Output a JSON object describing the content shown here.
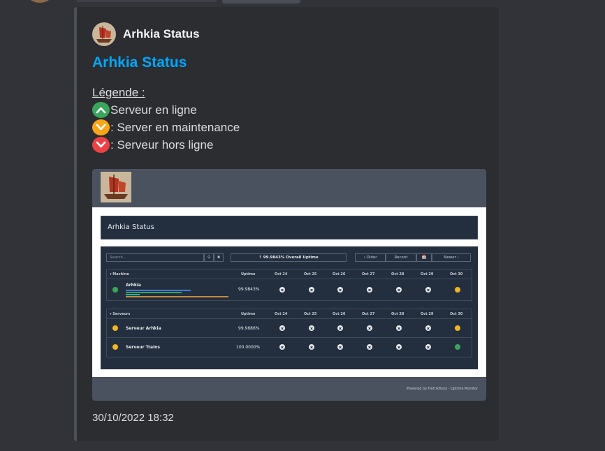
{
  "embed": {
    "author_name": "Arhkia Status",
    "title": "Arhkia Status",
    "legend_title": "Légende :",
    "legend": [
      {
        "color": "green",
        "icon": "chevron-up-icon",
        "text": "Serveur en ligne"
      },
      {
        "color": "yellow",
        "icon": "chevron-down-icon",
        "text": ": Server en maintenance"
      },
      {
        "color": "red",
        "icon": "chevron-down-icon",
        "text": ": Serveur hors ligne"
      }
    ],
    "timestamp": "30/10/2022 18:32",
    "colors": {
      "link": "#00a8fc",
      "green": "#3ba55d",
      "yellow": "#faa61a",
      "red": "#ed4245"
    }
  },
  "screenshot": {
    "page_title": "Arhkia Status",
    "search_placeholder": "Search...",
    "overall_uptime": "↑ 99.9843% Overall Uptime",
    "nav": [
      "‹ Older",
      "Recent",
      "📅",
      "Newer ›"
    ],
    "days": [
      "Oct 24",
      "Oct 25",
      "Oct 26",
      "Oct 27",
      "Oct 28",
      "Oct 29",
      "Oct 30"
    ],
    "uptime_header": "Uptime",
    "groups": [
      {
        "name": "▾ Machine",
        "rows": [
          {
            "name": "Arhkia",
            "uptime": "99.9843%",
            "status_icon": "up",
            "days": [
              "x",
              "x",
              "x",
              "x",
              "x",
              "x",
              "warn"
            ]
          }
        ]
      },
      {
        "name": "▾ Serveurs",
        "rows": [
          {
            "name": "Serveur Arhkia",
            "uptime": "99.9686%",
            "status_icon": "down",
            "days": [
              "x",
              "x",
              "x",
              "x",
              "x",
              "x",
              "warn"
            ]
          },
          {
            "name": "Serveur Trains",
            "uptime": "100.0000%",
            "status_icon": "down",
            "days": [
              "x",
              "x",
              "x",
              "x",
              "x",
              "x",
              "up"
            ]
          }
        ]
      }
    ],
    "footer": "Powered by HetrixTools - Uptime Monitor"
  }
}
